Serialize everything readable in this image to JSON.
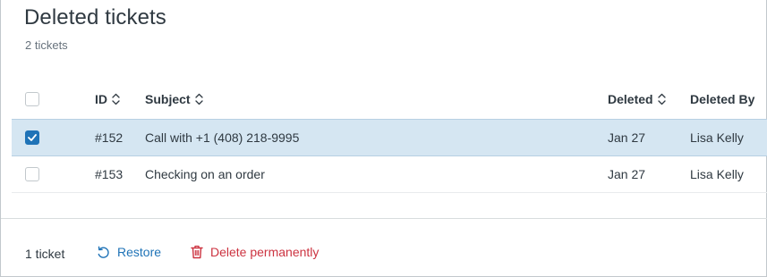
{
  "page": {
    "title": "Deleted tickets",
    "count_label": "2 tickets"
  },
  "table": {
    "columns": {
      "id": "ID",
      "subject": "Subject",
      "deleted": "Deleted",
      "deleted_by": "Deleted By"
    },
    "rows": [
      {
        "selected": true,
        "id": "#152",
        "subject": "Call with +1 (408) 218-9995",
        "deleted": "Jan 27",
        "deleted_by": "Lisa Kelly"
      },
      {
        "selected": false,
        "id": "#153",
        "subject": "Checking on an order",
        "deleted": "Jan 27",
        "deleted_by": "Lisa Kelly"
      }
    ]
  },
  "footer": {
    "selection_count": "1 ticket",
    "restore_label": "Restore",
    "delete_label": "Delete permanently"
  },
  "colors": {
    "accent": "#1f73b7",
    "danger": "#cc3340",
    "selected_row": "#d5e6f2"
  }
}
